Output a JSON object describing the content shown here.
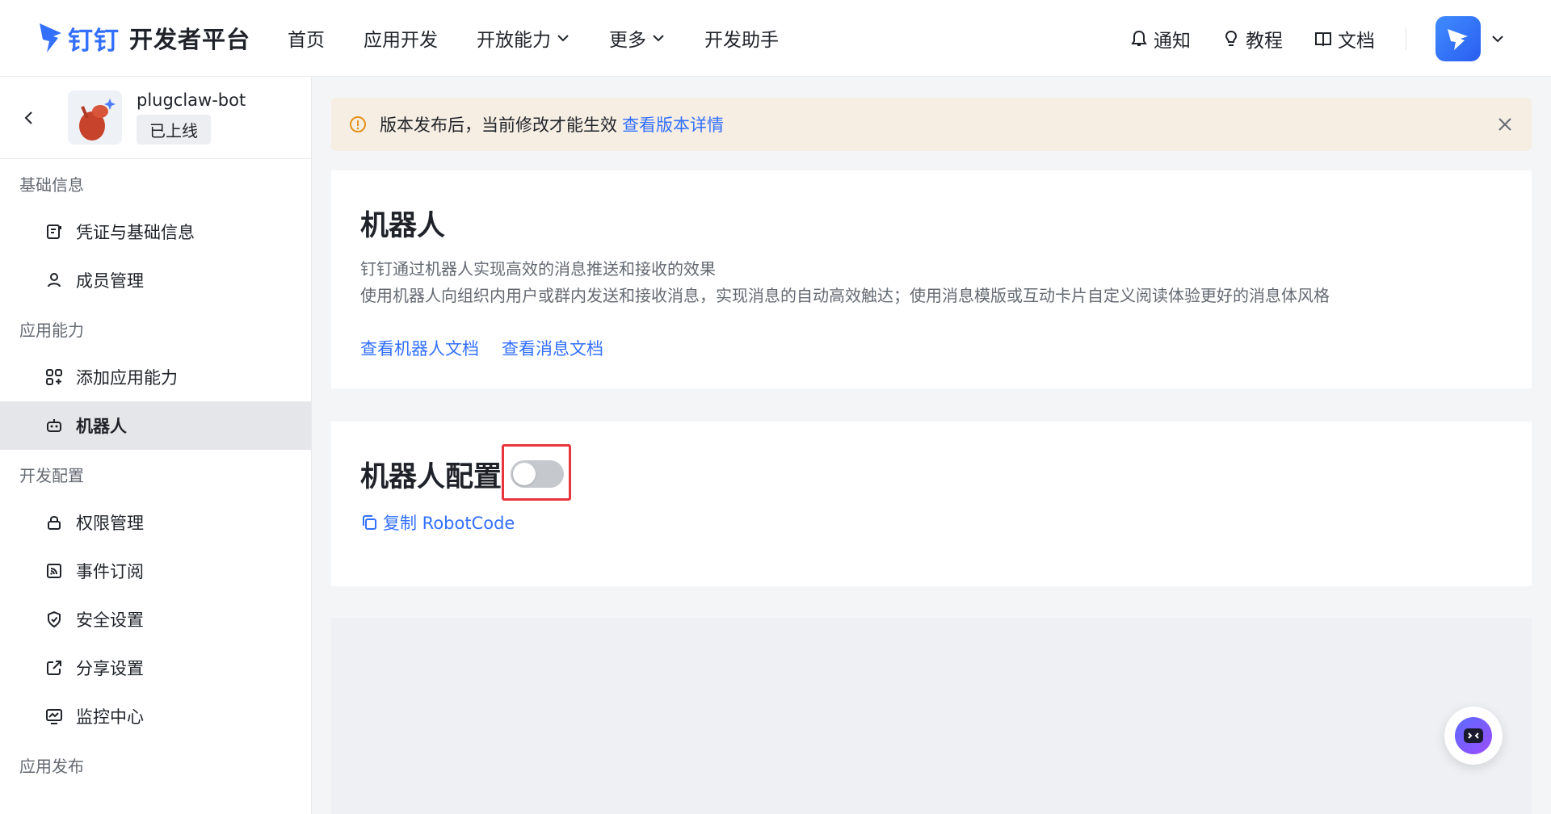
{
  "brand": {
    "name": "钉钉",
    "subtitle": "开发者平台",
    "logo_icon": "dingtalk-logo-icon",
    "accent": "#3370ff"
  },
  "nav": {
    "items": [
      {
        "label": "首页",
        "dropdown": false
      },
      {
        "label": "应用开发",
        "dropdown": false
      },
      {
        "label": "开放能力",
        "dropdown": true
      },
      {
        "label": "更多",
        "dropdown": true
      },
      {
        "label": "开发助手",
        "dropdown": false
      }
    ]
  },
  "header_actions": {
    "notify": {
      "label": "通知",
      "icon": "bell-icon"
    },
    "tutorial": {
      "label": "教程",
      "icon": "lightbulb-icon"
    },
    "docs": {
      "label": "文档",
      "icon": "book-icon"
    }
  },
  "app": {
    "name": "plugclaw-bot",
    "status": "已上线"
  },
  "sidebar": {
    "sections": [
      {
        "label": "基础信息",
        "items": [
          {
            "label": "凭证与基础信息",
            "icon": "credential-icon",
            "active": false
          },
          {
            "label": "成员管理",
            "icon": "user-icon",
            "active": false
          }
        ]
      },
      {
        "label": "应用能力",
        "items": [
          {
            "label": "添加应用能力",
            "icon": "grid-add-icon",
            "active": false
          },
          {
            "label": "机器人",
            "icon": "robot-icon",
            "active": true
          }
        ]
      },
      {
        "label": "开发配置",
        "items": [
          {
            "label": "权限管理",
            "icon": "lock-icon",
            "active": false
          },
          {
            "label": "事件订阅",
            "icon": "rss-icon",
            "active": false
          },
          {
            "label": "安全设置",
            "icon": "shield-icon",
            "active": false
          },
          {
            "label": "分享设置",
            "icon": "share-icon",
            "active": false
          },
          {
            "label": "监控中心",
            "icon": "monitor-icon",
            "active": false
          }
        ]
      },
      {
        "label": "应用发布",
        "items": []
      }
    ]
  },
  "notice": {
    "text": "版本发布后，当前修改才能生效",
    "link": "查看版本详情",
    "bg": "#f6ede3",
    "icon_color": "#e5921a"
  },
  "robot_card": {
    "title": "机器人",
    "desc1": "钉钉通过机器人实现高效的消息推送和接收的效果",
    "desc2": "使用机器人向组织内用户或群内发送和接收消息，实现消息的自动高效触达；使用消息模版或互动卡片自定义阅读体验更好的消息体风格",
    "link_robot_doc": "查看机器人文档",
    "link_msg_doc": "查看消息文档"
  },
  "config_card": {
    "title": "机器人配置",
    "toggle_on": false,
    "copy_label": "复制 RobotCode",
    "highlight_color": "#e8353b"
  }
}
